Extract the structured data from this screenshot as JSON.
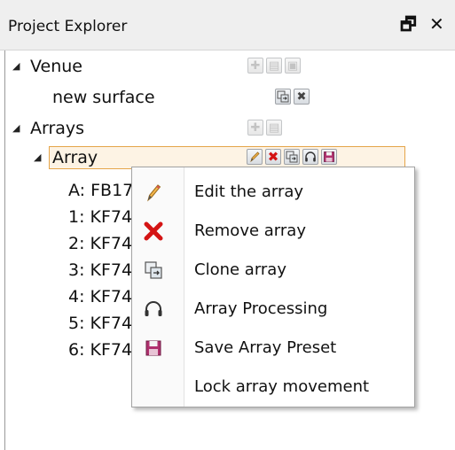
{
  "panel": {
    "title": "Project Explorer",
    "float_glyph": "🗗",
    "close_glyph": "✕"
  },
  "tree": {
    "venue_label": "Venue",
    "surface_label": "new surface",
    "arrays_label": "Arrays",
    "array_label": "Array",
    "children": [
      "A: FB17",
      "1: KF74",
      "2: KF74",
      "3: KF74",
      "4: KF74",
      "5: KF74",
      "6: KF74"
    ]
  },
  "context_menu": {
    "items": [
      {
        "label": "Edit the array",
        "icon": "pencil-icon"
      },
      {
        "label": "Remove array",
        "icon": "red-x-icon"
      },
      {
        "label": "Clone array",
        "icon": "clone-icon"
      },
      {
        "label": "Array Processing",
        "icon": "headphones-icon"
      },
      {
        "label": "Save Array Preset",
        "icon": "save-icon"
      },
      {
        "label": "Lock array movement",
        "icon": ""
      }
    ]
  },
  "colors": {
    "selection_border": "#e5a54a",
    "remove_red": "#d41414",
    "save_purple": "#b0306e"
  }
}
